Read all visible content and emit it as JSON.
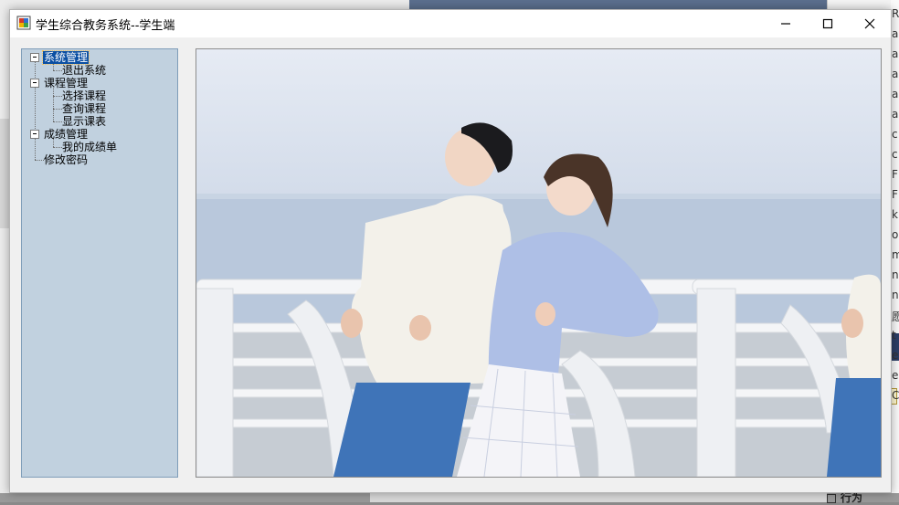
{
  "window": {
    "title": "学生综合教务系统--学生端"
  },
  "tree": {
    "nodes": [
      {
        "label": "系统管理",
        "selected": true
      },
      {
        "label": "退出系统"
      },
      {
        "label": "课程管理"
      },
      {
        "label": "选择课程"
      },
      {
        "label": "查询课程"
      },
      {
        "label": "显示课表"
      },
      {
        "label": "成绩管理"
      },
      {
        "label": "我的成绩单"
      },
      {
        "label": "修改密码"
      }
    ]
  },
  "image": {
    "description_icon": "photo-couple-seaside"
  },
  "background": {
    "right_letters": [
      "R",
      "a",
      "a",
      "a",
      "a",
      "a",
      "c",
      "c",
      "F",
      "F",
      "k",
      "o",
      "m",
      "n",
      "n",
      "愿",
      "t",
      "e",
      "e",
      "C"
    ],
    "bottom_label": "行为"
  },
  "colors": {
    "tree_bg": "#c1d1df",
    "selection": "#0b4fa3",
    "window_bg": "#f0f0f0"
  }
}
